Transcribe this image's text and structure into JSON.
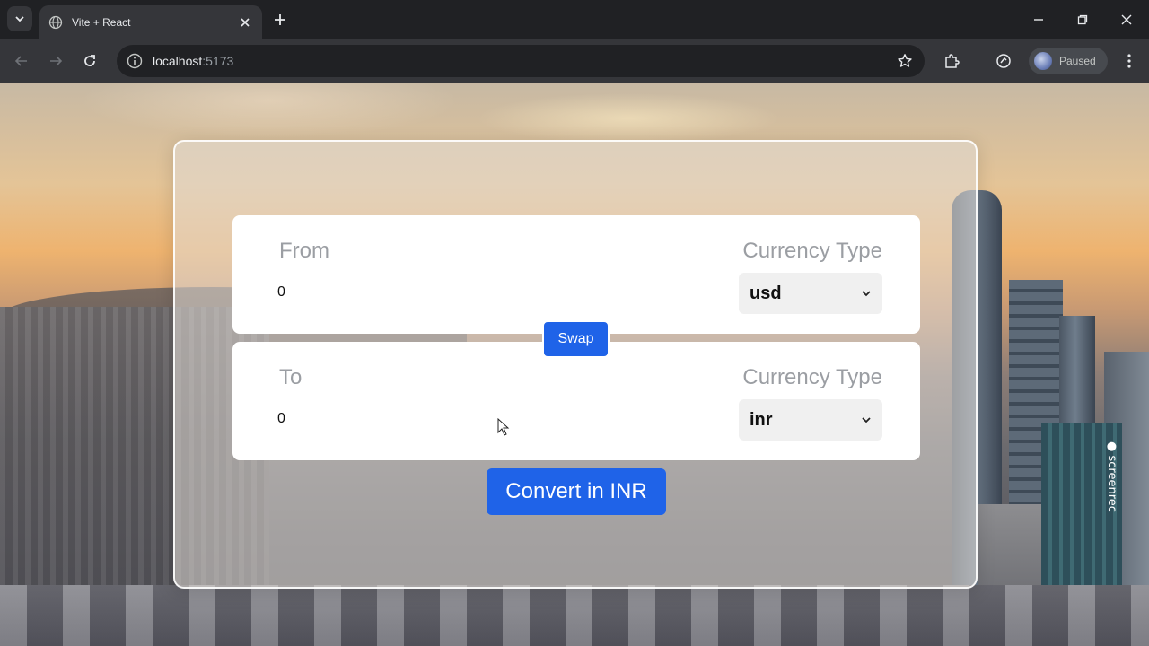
{
  "browser": {
    "tab_title": "Vite + React",
    "url_host": "localhost",
    "url_port": ":5173",
    "profile_label": "Paused"
  },
  "app": {
    "from_label": "From",
    "from_amount": "0",
    "from_currency_label": "Currency Type",
    "from_currency": "usd",
    "swap_label": "Swap",
    "to_label": "To",
    "to_amount": "0",
    "to_currency_label": "Currency Type",
    "to_currency": "inr",
    "convert_label": "Convert in INR"
  },
  "overlay": {
    "watermark": "screenrec"
  },
  "colors": {
    "accent": "#1f63e8",
    "chrome_dark": "#202124",
    "chrome_toolbar": "#35363a"
  }
}
